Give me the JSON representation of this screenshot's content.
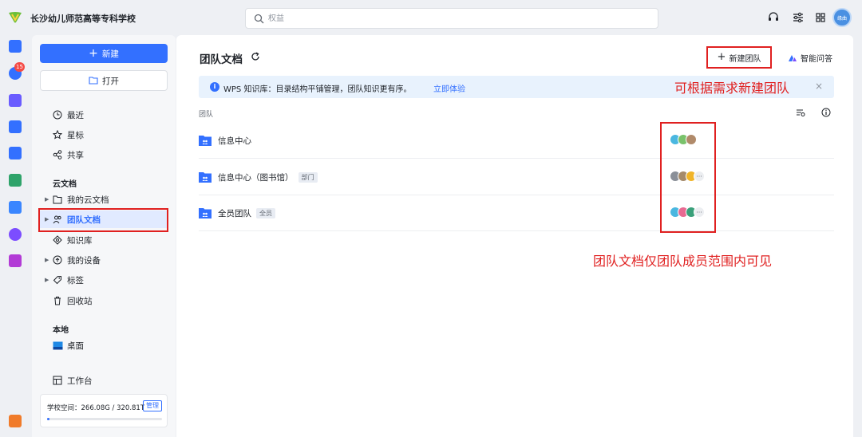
{
  "header": {
    "school_name": "长沙幼儿师范高等专科学校",
    "search_placeholder": "权益",
    "avatar_text": "缘曲"
  },
  "rail": {
    "badge_count": "15",
    "icons": [
      "docs-icon",
      "clock-icon",
      "mail-icon",
      "meeting-icon",
      "calendar-icon",
      "sheet-icon",
      "screen-icon",
      "chat-icon",
      "pdf-icon",
      "app-icon"
    ]
  },
  "sidebar": {
    "new_label": "新建",
    "open_label": "打开",
    "quick": [
      {
        "label": "最近",
        "icon": "clock-icon"
      },
      {
        "label": "星标",
        "icon": "star-icon"
      },
      {
        "label": "共享",
        "icon": "share-icon"
      }
    ],
    "cloud_title": "云文档",
    "cloud_items": [
      {
        "label": "我的云文档",
        "icon": "folder-icon",
        "arrow": true
      },
      {
        "label": "团队文档",
        "icon": "team-icon",
        "arrow": true,
        "active": true
      },
      {
        "label": "知识库",
        "icon": "knowledge-icon",
        "arrow": false
      },
      {
        "label": "我的设备",
        "icon": "cloud-device-icon",
        "arrow": true
      },
      {
        "label": "标签",
        "icon": "tag-icon",
        "arrow": true
      },
      {
        "label": "回收站",
        "icon": "trash-icon",
        "arrow": false
      }
    ],
    "local_title": "本地",
    "local_items": [
      {
        "label": "桌面",
        "icon": "desktop-icon"
      }
    ],
    "workbench_label": "工作台",
    "storage": {
      "text": "学校空间：266.08G / 320.81T",
      "manage_label": "管理",
      "used_fraction": 0.02
    }
  },
  "main": {
    "title": "团队文档",
    "new_team_label": "新建团队",
    "ai_qa_label": "智能问答",
    "banner_text": "WPS 知识库：目录结构平铺管理，团队知识更有序。",
    "banner_link": "立即体验",
    "annotation_new_team": "可根据需求新建团队",
    "list_header": "团队",
    "annotation_visibility": "团队文档仅团队成员范围内可见",
    "teams": [
      {
        "name": "信息中心",
        "tag": "",
        "members": [
          "#4ab7e0",
          "#79c26b",
          "#b08a6a"
        ],
        "more": false
      },
      {
        "name": "信息中心（图书馆）",
        "tag": "部门",
        "members": [
          "#8a8f98",
          "#a58a6a",
          "#f0b429"
        ],
        "more": true
      },
      {
        "name": "全员团队",
        "tag": "全员",
        "members": [
          "#4ab7e0",
          "#e86a92",
          "#3aa07a"
        ],
        "more": true
      }
    ]
  },
  "colors": {
    "accent": "#3370ff",
    "annotation_red": "#e02020",
    "active_bg": "#e1eaff"
  }
}
